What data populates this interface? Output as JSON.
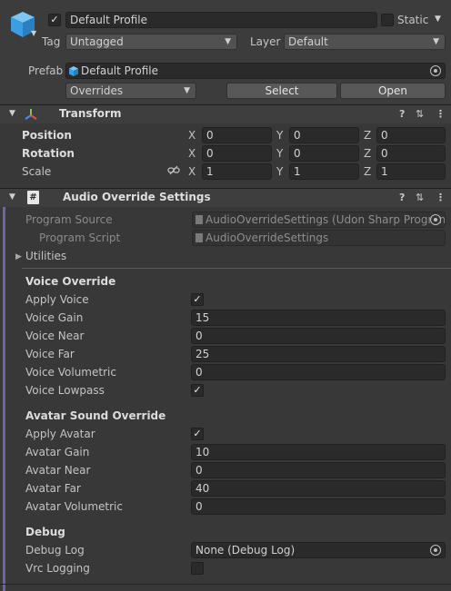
{
  "header": {
    "enabled": true,
    "name": "Default Profile",
    "static_label": "Static",
    "static_checked": false,
    "tag_label": "Tag",
    "tag_value": "Untagged",
    "layer_label": "Layer",
    "layer_value": "Default",
    "prefab_label": "Prefab",
    "prefab_value": "Default Profile",
    "overrides_value": "Overrides",
    "select_label": "Select",
    "open_label": "Open"
  },
  "transform": {
    "title": "Transform",
    "rows": [
      {
        "label": "Position",
        "x": "0",
        "y": "0",
        "z": "0"
      },
      {
        "label": "Rotation",
        "x": "0",
        "y": "0",
        "z": "0"
      },
      {
        "label": "Scale",
        "x": "1",
        "y": "1",
        "z": "1"
      }
    ],
    "axis": {
      "x": "X",
      "y": "Y",
      "z": "Z"
    }
  },
  "audio": {
    "title": "Audio Override Settings",
    "program_source_label": "Program Source",
    "program_source_value": "AudioOverrideSettings (Udon Sharp Program",
    "program_script_label": "Program Script",
    "program_script_value": "AudioOverrideSettings",
    "utilities_label": "Utilities",
    "voice_section": "Voice Override",
    "apply_voice_label": "Apply Voice",
    "apply_voice": true,
    "voice_gain_label": "Voice Gain",
    "voice_gain": "15",
    "voice_near_label": "Voice Near",
    "voice_near": "0",
    "voice_far_label": "Voice Far",
    "voice_far": "25",
    "voice_volumetric_label": "Voice Volumetric",
    "voice_volumetric": "0",
    "voice_lowpass_label": "Voice Lowpass",
    "voice_lowpass": true,
    "avatar_section": "Avatar Sound Override",
    "apply_avatar_label": "Apply Avatar",
    "apply_avatar": true,
    "avatar_gain_label": "Avatar Gain",
    "avatar_gain": "10",
    "avatar_near_label": "Avatar Near",
    "avatar_near": "0",
    "avatar_far_label": "Avatar Far",
    "avatar_far": "40",
    "avatar_volumetric_label": "Avatar Volumetric",
    "avatar_volumetric": "0",
    "debug_section": "Debug",
    "debug_log_label": "Debug Log",
    "debug_log_value": "None (Debug Log)",
    "vrc_logging_label": "Vrc Logging",
    "vrc_logging": false
  },
  "icons": {
    "help": "?",
    "presets": "⇅",
    "menu": "⋮",
    "check": "✓"
  },
  "colors": {
    "background": "#383838",
    "field": "#2a2a2a",
    "accent_bar": "#7b6fb0",
    "cube_icon": "#4aa8e6"
  }
}
